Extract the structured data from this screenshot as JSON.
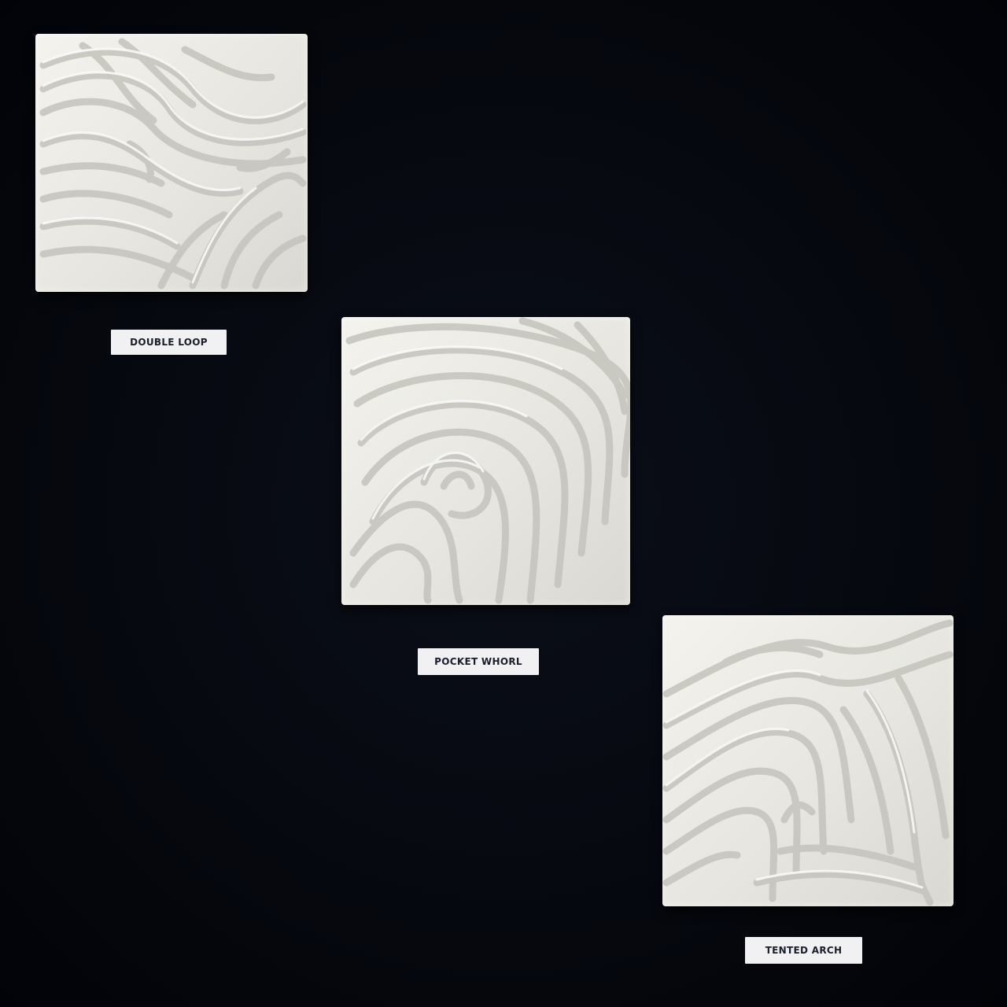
{
  "artworks": [
    {
      "label": "DOUBLE LOOP"
    },
    {
      "label": "POCKET WHORL"
    },
    {
      "label": "TENTED ARCH"
    }
  ],
  "colors": {
    "background": "#05070d",
    "tile": "#eeede8",
    "ridge_shadow": "#b9b8b2",
    "label_bg": "#f1f1f4",
    "label_text": "#1a1d2a"
  }
}
